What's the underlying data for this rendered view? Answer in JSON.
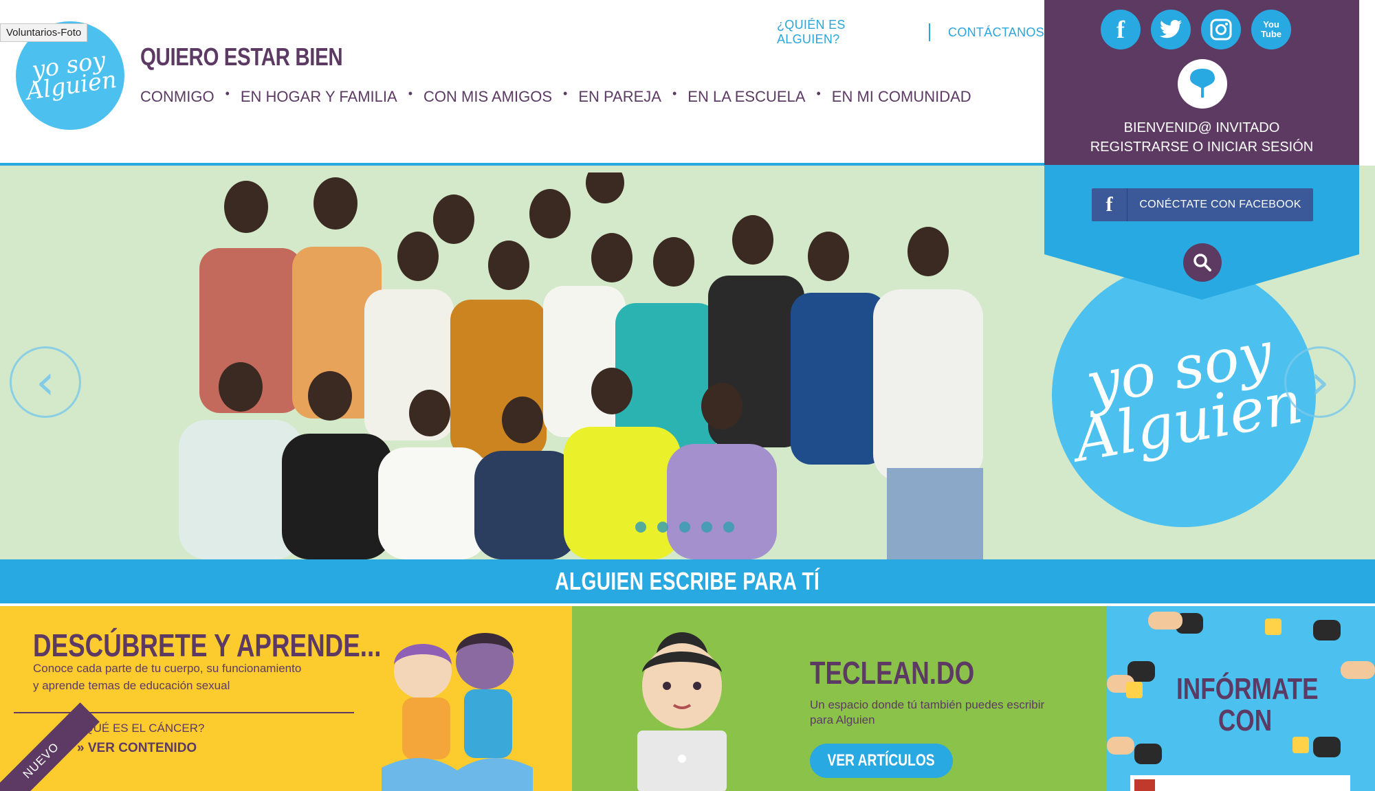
{
  "header": {
    "tooltip": "Voluntarios-Foto",
    "logo_text": "yo soy Alguien",
    "site_title": "QUIERO ESTAR BIEN",
    "top_links": {
      "who": "¿QUIÉN ES ALGUIEN?",
      "contact": "CONTÁCTANOS"
    },
    "nav": [
      "CONMIGO",
      "EN HOGAR Y FAMILIA",
      "CON MIS AMIGOS",
      "EN PAREJA",
      "EN LA ESCUELA",
      "EN MI COMUNIDAD"
    ]
  },
  "user_panel": {
    "social": [
      {
        "name": "facebook-icon",
        "glyph": "f"
      },
      {
        "name": "twitter-icon",
        "glyph": "t"
      },
      {
        "name": "instagram-icon",
        "glyph": "◙"
      },
      {
        "name": "youtube-icon",
        "glyph": "You Tube"
      }
    ],
    "welcome": "BIENVENID@ INVITADO",
    "login": "REGISTRARSE O INICIAR SESIÓN",
    "facebook_connect": "CONÉCTATE CON FACEBOOK"
  },
  "hero": {
    "logo_text": "yo soy Alguien",
    "prev": "‹",
    "next": "›",
    "slides": 5,
    "active_slide": 1
  },
  "banner": {
    "title": "ALGUIEN ESCRIBE PARA TÍ"
  },
  "cards": {
    "learn": {
      "title": "DESCÚBRETE Y APRENDE...",
      "desc_1": "Conoce cada parte de tu cuerpo, su funcionamiento",
      "desc_2": "y aprende temas de educación sexual",
      "badge": "NUEVO",
      "question": "¿QUÉ ES EL CÁNCER?",
      "link": "» VER CONTENIDO"
    },
    "teclean": {
      "title": "TECLEAN.DO",
      "desc_1": "Un espacio donde tú también puedes escribir",
      "desc_2": "para Alguien",
      "button": "VER ARTÍCULOS"
    },
    "inform": {
      "title": "INFÓRMATE CON"
    }
  },
  "colors": {
    "purple": "#5d3a62",
    "blue": "#29a9e1",
    "light_blue": "#4cc1ef",
    "yellow": "#fccc2e",
    "green": "#8bc34a",
    "hero_bg": "#d4e9c9"
  }
}
